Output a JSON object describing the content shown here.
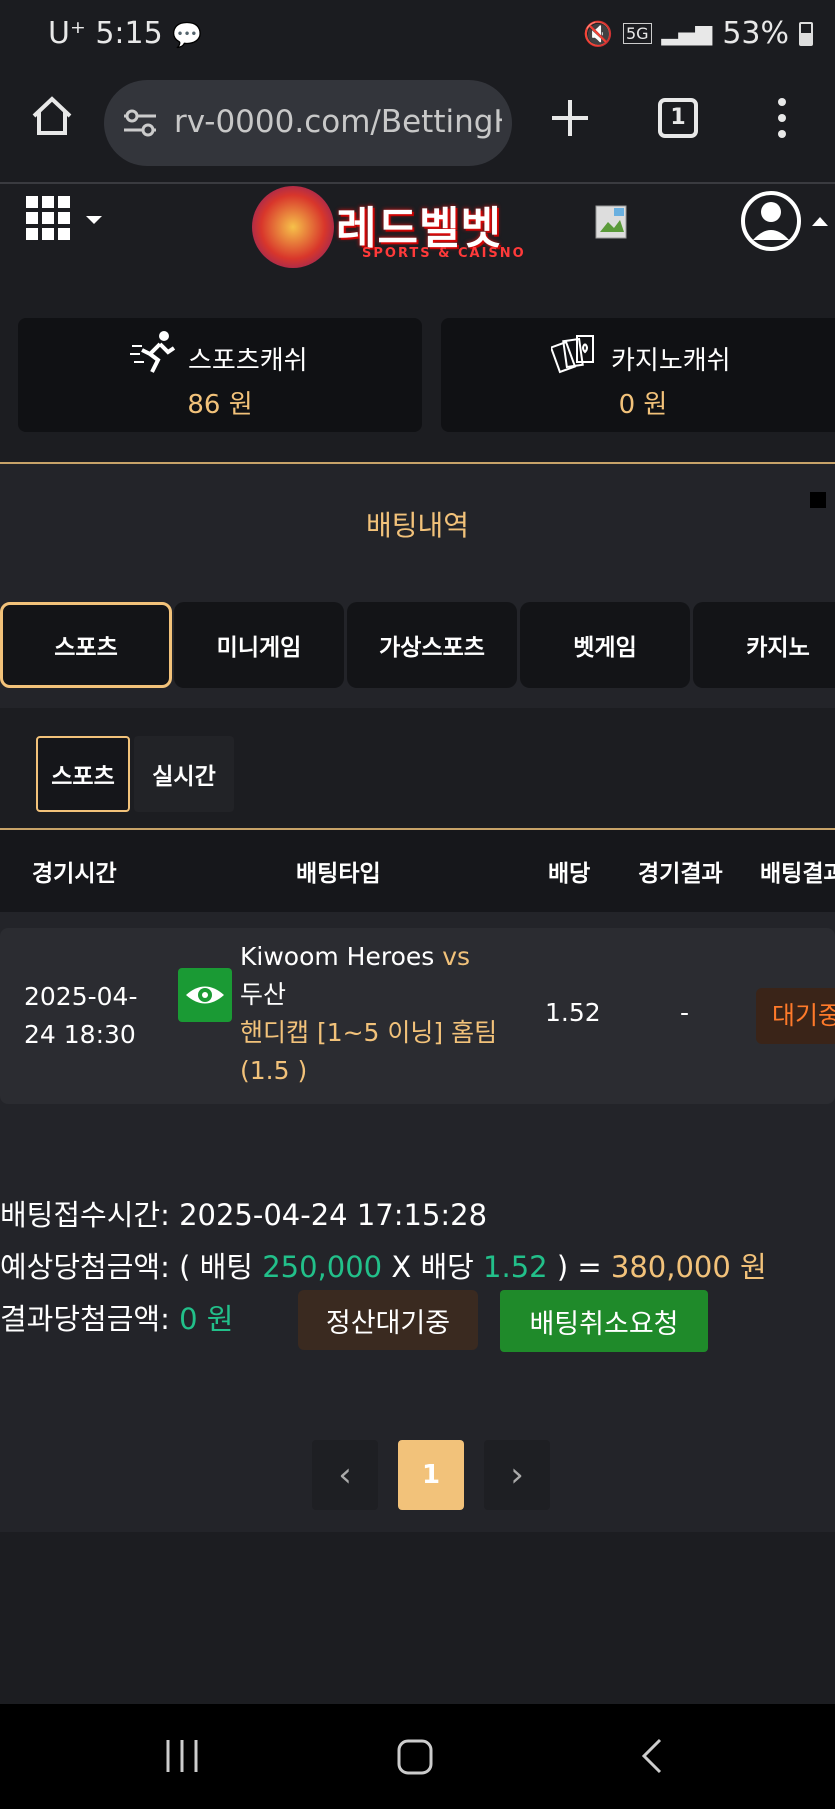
{
  "status_bar": {
    "carrier": "U⁺",
    "time": "5:15",
    "network": "5G",
    "battery": "53%"
  },
  "browser": {
    "url": "rv-0000.com/BettingH",
    "tab_count": "1"
  },
  "site": {
    "logo_text": "레드벨벳",
    "logo_sub": "SPORTS & CAISNO"
  },
  "balances": [
    {
      "label": "스포츠캐쉬",
      "value": "86 원"
    },
    {
      "label": "카지노캐쉬",
      "value": "0 원"
    }
  ],
  "section_title": "배팅내역",
  "tabs": [
    "스포츠",
    "미니게임",
    "가상스포츠",
    "벳게임",
    "카지노"
  ],
  "sub_tabs": [
    "스포츠",
    "실시간"
  ],
  "table": {
    "headers": [
      "경기시간",
      "배팅타입",
      "배당",
      "경기결과",
      "배팅결과"
    ],
    "row": {
      "time": "2025-04-24 18:30",
      "home": "Kiwoom Heroes",
      "vs": "vs",
      "away": "두산",
      "bet_type": "핸디캡 [1~5 이닝] 홈팀 (1.5 )",
      "odds": "1.52",
      "result": "-",
      "bet_result": "대기중"
    }
  },
  "details": {
    "received_label": "배팅접수시간:",
    "received_time": "2025-04-24 17:15:28",
    "expected_label": "예상당첨금액:",
    "open_paren": "( 배팅",
    "bet_amount": "250,000",
    "times": "X 배당",
    "odds": "1.52",
    "close_paren": ") =",
    "expected_amount": "380,000 원",
    "result_label": "결과당첨금액:",
    "result_amount": "0 원"
  },
  "buttons": {
    "pending": "정산대기중",
    "cancel": "배팅취소요청"
  },
  "pagination": {
    "prev": "‹",
    "current": "1",
    "next": "›"
  },
  "colors": {
    "accent_gold": "#f2c27a",
    "green": "#22c08a",
    "button_green": "#1f8a2a",
    "pending_orange": "#ff7a2a"
  }
}
